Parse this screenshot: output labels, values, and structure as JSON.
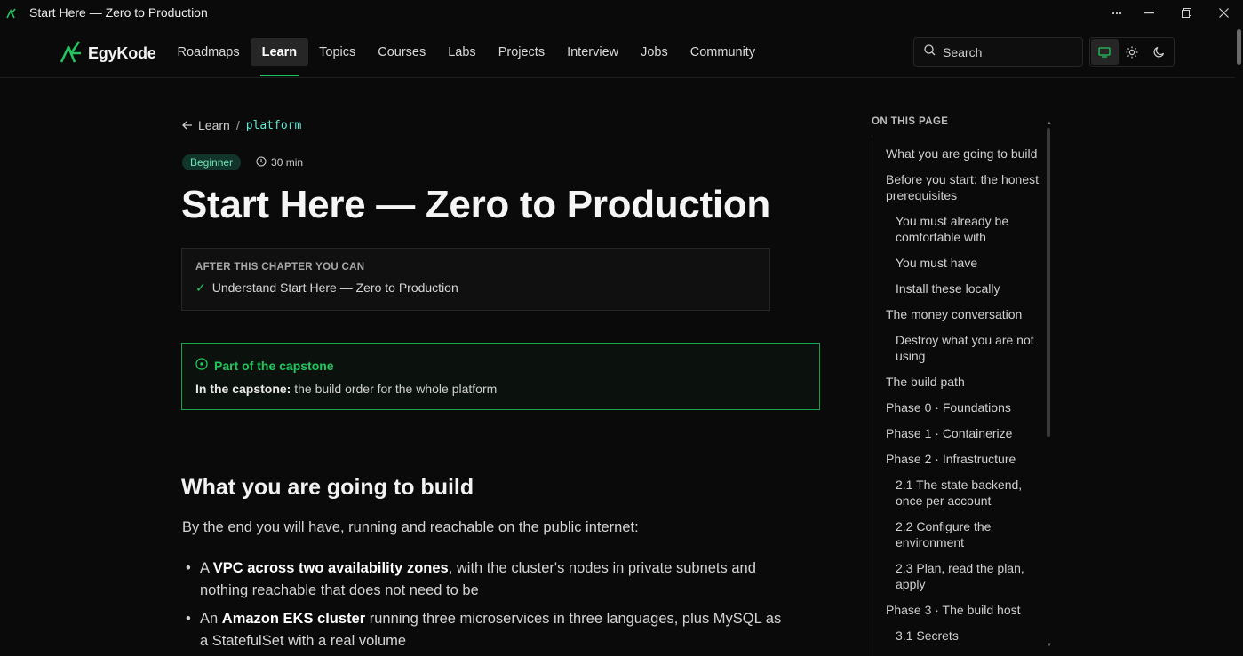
{
  "window": {
    "title": "Start Here — Zero to Production"
  },
  "brand": {
    "name": "EgyKode",
    "accent": "#22c55e"
  },
  "nav": {
    "items": [
      {
        "label": "Roadmaps"
      },
      {
        "label": "Learn",
        "active": true
      },
      {
        "label": "Topics"
      },
      {
        "label": "Courses"
      },
      {
        "label": "Labs"
      },
      {
        "label": "Projects"
      },
      {
        "label": "Interview"
      },
      {
        "label": "Jobs"
      },
      {
        "label": "Community"
      }
    ]
  },
  "search": {
    "placeholder": "Search"
  },
  "theme": {
    "options": [
      "monitor-icon",
      "sun-icon",
      "moon-icon"
    ],
    "selected": "monitor-icon"
  },
  "breadcrumb": {
    "back_label": "Learn",
    "separator": "/",
    "current": "platform"
  },
  "meta": {
    "level": "Beginner",
    "duration": "30 min"
  },
  "page": {
    "title": "Start Here — Zero to Production"
  },
  "outcomes": {
    "label": "AFTER THIS CHAPTER YOU CAN",
    "items": [
      "Understand Start Here — Zero to Production"
    ]
  },
  "capstone": {
    "heading": "Part of the capstone",
    "lead": "In the capstone:",
    "text": " the build order for the whole platform"
  },
  "section": {
    "heading": "What you are going to build",
    "intro": "By the end you will have, running and reachable on the public internet:",
    "bullets": [
      {
        "pre": "A ",
        "bold": "VPC across two availability zones",
        "post": ", with the cluster's nodes in private subnets and nothing reachable that does not need to be"
      },
      {
        "pre": "An ",
        "bold": "Amazon EKS cluster",
        "post": " running three microservices in three languages, plus MySQL as a StatefulSet with a real volume"
      }
    ]
  },
  "toc": {
    "title": "ON THIS PAGE",
    "items": [
      {
        "label": "What you are going to build",
        "level": 1
      },
      {
        "label": "Before you start: the honest prerequisites",
        "level": 1
      },
      {
        "label": "You must already be comfortable with",
        "level": 2
      },
      {
        "label": "You must have",
        "level": 2
      },
      {
        "label": "Install these locally",
        "level": 2
      },
      {
        "label": "The money conversation",
        "level": 1
      },
      {
        "label": "Destroy what you are not using",
        "level": 2
      },
      {
        "label": "The build path",
        "level": 1
      },
      {
        "label": "Phase 0 · Foundations",
        "level": 1
      },
      {
        "label": "Phase 1 · Containerize",
        "level": 1
      },
      {
        "label": "Phase 2 · Infrastructure",
        "level": 1
      },
      {
        "label": "2.1 The state backend, once per account",
        "level": 2
      },
      {
        "label": "2.2 Configure the environment",
        "level": 2
      },
      {
        "label": "2.3 Plan, read the plan, apply",
        "level": 2
      },
      {
        "label": "Phase 3 · The build host",
        "level": 1
      },
      {
        "label": "3.1 Secrets",
        "level": 2
      }
    ]
  }
}
